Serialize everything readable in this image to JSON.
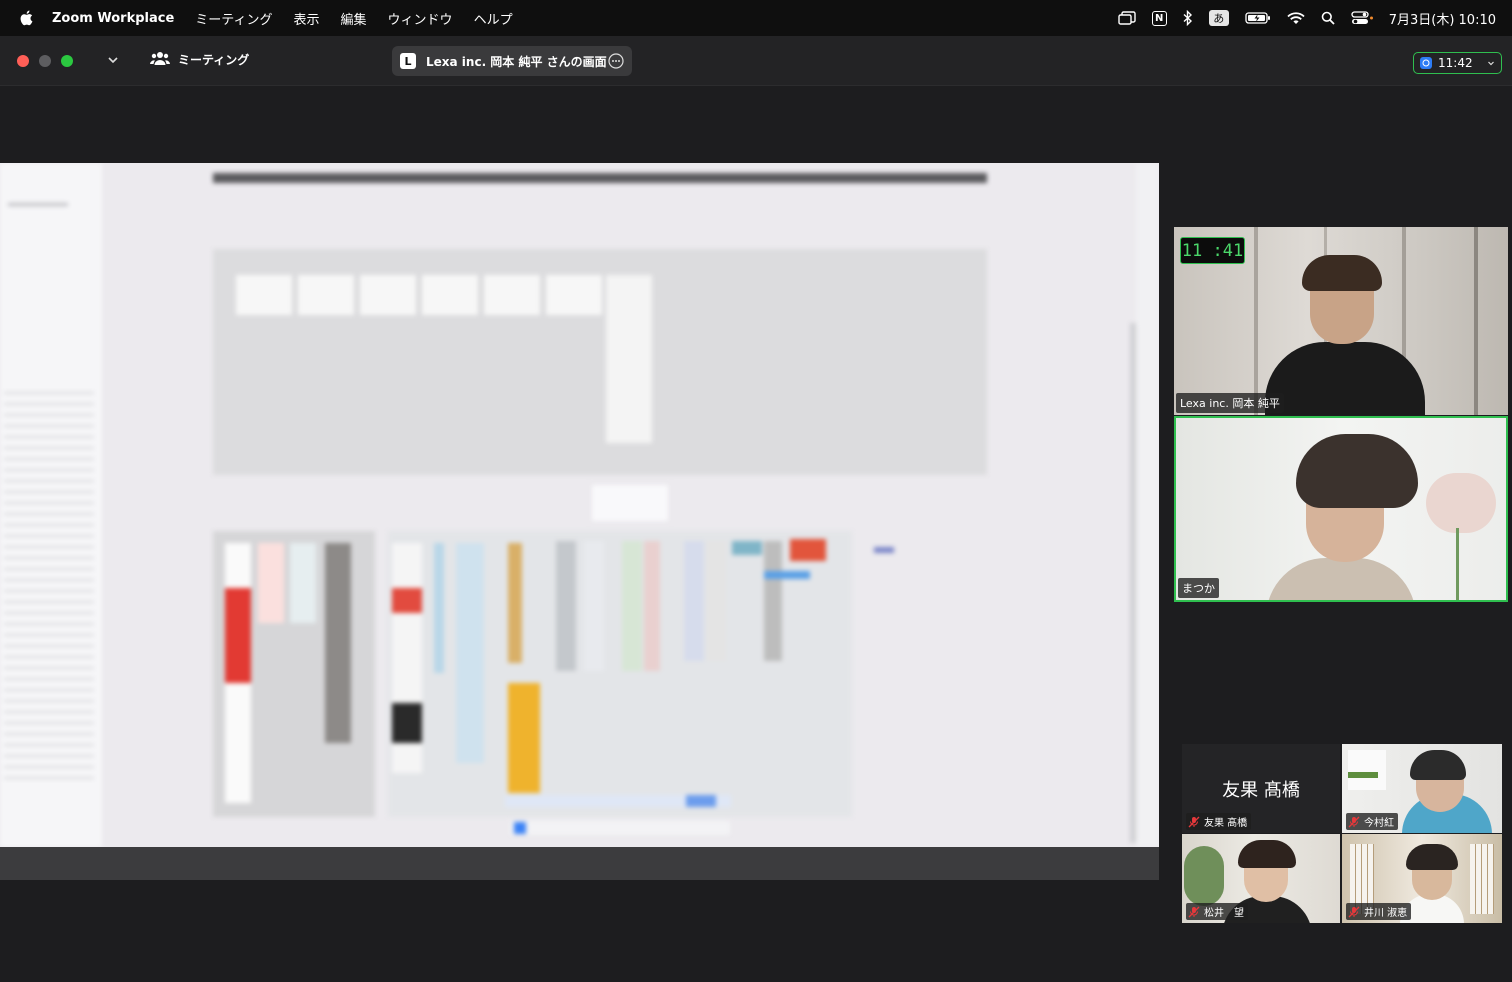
{
  "menubar": {
    "app_name": "Zoom Workplace",
    "items": [
      "ミーティング",
      "表示",
      "編集",
      "ウィンドウ",
      "ヘルプ"
    ],
    "status_icons": [
      "stage-manager-icon",
      "notion-icon",
      "bluetooth-icon",
      "input-method-icon",
      "battery-icon",
      "wifi-icon",
      "search-icon",
      "control-center-icon"
    ],
    "ime_glyph": "あ",
    "notion_glyph": "N",
    "datetime": "7月3日(木) 10:10"
  },
  "toolbar": {
    "meeting_label": "ミーティング",
    "share_badge": "L",
    "share_title": "Lexa inc. 岡本 純平 さんの画面",
    "timer": "11:42"
  },
  "speaker_tiles": [
    {
      "name": "Lexa inc. 岡本 純平",
      "clock": "11 :41"
    },
    {
      "name": "まつか",
      "active": true
    }
  ],
  "gallery": [
    {
      "name": "友果 髙橋",
      "big_name": "友果 髙橋",
      "muted": true
    },
    {
      "name": "今村紅",
      "muted": true
    },
    {
      "name": "松井　望",
      "muted": true
    },
    {
      "name": "井川 淑恵",
      "muted": true
    }
  ],
  "colors": {
    "active_border": "#2fbf4f",
    "clock_text": "#4bd86a",
    "mic_muted": "#e5383b"
  }
}
